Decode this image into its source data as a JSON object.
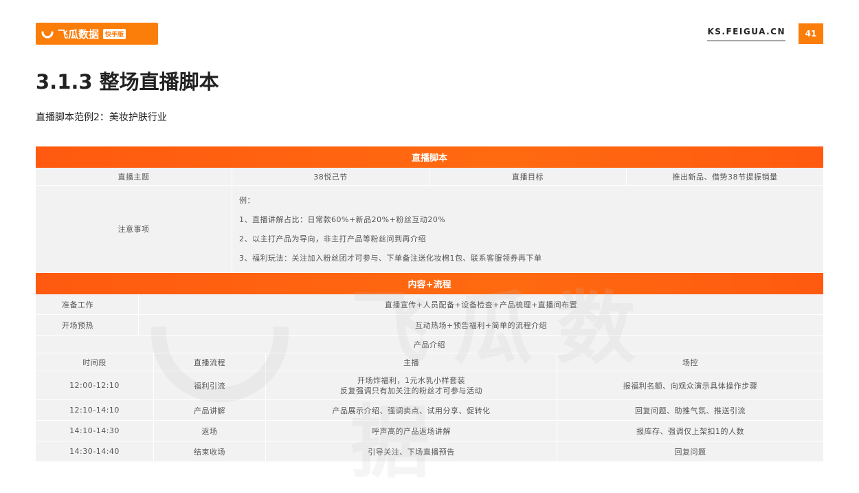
{
  "header": {
    "brand": "飞瓜数据",
    "badge": "快手版",
    "site": "KS.FEIGUA.CN",
    "page_number": "41"
  },
  "title": "3.1.3 整场直播脚本",
  "subtitle": "直播脚本范例2：美妆护肤行业",
  "watermark": "飞瓜数据",
  "table": {
    "title": "直播脚本",
    "theme_label": "直播主题",
    "theme_value": "38悦己节",
    "goal_label": "直播目标",
    "goal_value": "推出新品、借势38节提振销量",
    "notes_label": "注意事项",
    "notes": [
      "例：",
      "1、直播讲解占比：日常款60%+新品20%+粉丝互动20%",
      "2、以主打产品为导向，非主打产品等粉丝问到再介绍",
      "3、福利玩法：关注加入粉丝团才可参与、下单备注送化妆棉1包、联系客服领券再下单"
    ],
    "section_title": "内容+流程",
    "prep_label": "准备工作",
    "prep_value": "直播宣传+人员配备+设备检查+产品梳理+直播间布置",
    "warmup_label": "开场预热",
    "warmup_value": "互动热场+预告福利+简单的流程介绍",
    "product_intro": "产品介绍",
    "columns": [
      "时间段",
      "直播流程",
      "主播",
      "场控"
    ],
    "rows": [
      {
        "time": "12:00-12:10",
        "flow": "福利引流",
        "host_line1": "开场炸福利，1元水乳小样套装",
        "host_line2": "反复强调只有加关注的粉丝才可参与活动",
        "control": "报福利名额、向观众演示具体操作步骤"
      },
      {
        "time": "12:10-14:10",
        "flow": "产品讲解",
        "host_line1": "产品展示介绍、强调卖点、试用分享、促转化",
        "host_line2": "",
        "control": "回复问题、助推气氛、推送引流"
      },
      {
        "time": "14:10-14:30",
        "flow": "返场",
        "host_line1": "呼声高的产品返场讲解",
        "host_line2": "",
        "control": "报库存、强调仅上架扣1的人数"
      },
      {
        "time": "14:30-14:40",
        "flow": "结束收场",
        "host_line1": "引导关注、下场直播预告",
        "host_line2": "",
        "control": "回复问题"
      }
    ]
  },
  "colors": {
    "accent": "#fb7d0a",
    "header_bar": "#ff5a10",
    "cell_bg": "#f2f2f2"
  }
}
